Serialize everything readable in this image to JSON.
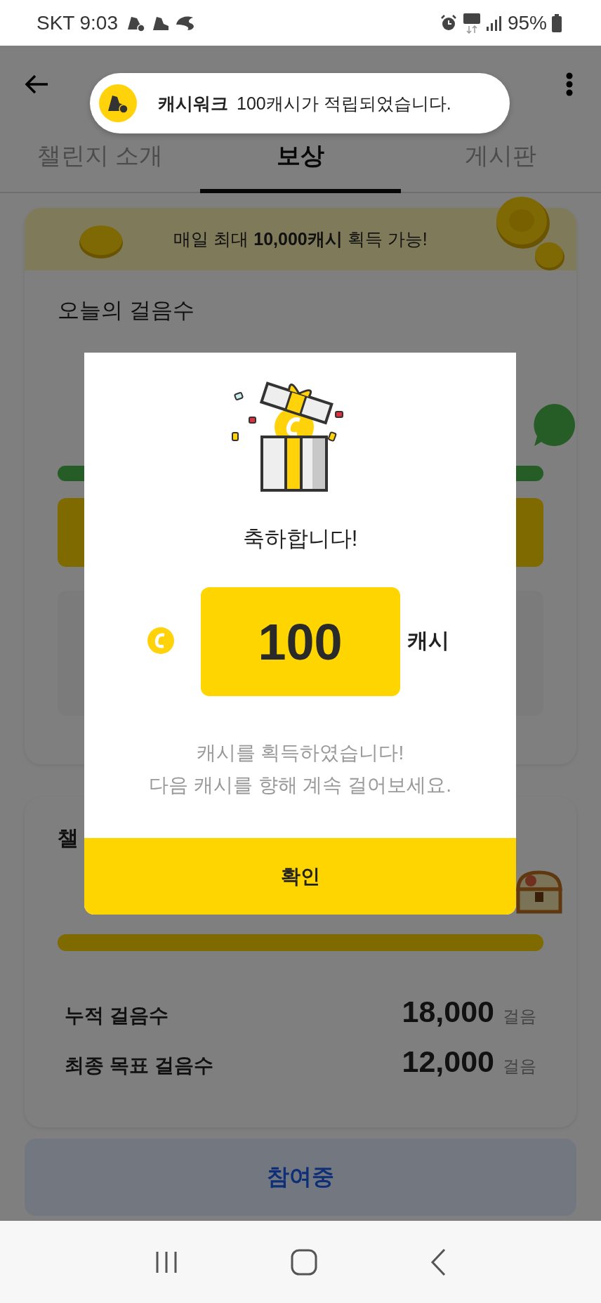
{
  "status_bar": {
    "carrier": "SKT",
    "time": "9:03",
    "battery": "95%"
  },
  "toast": {
    "app": "캐시워크",
    "message": "100캐시가 적립되었습니다."
  },
  "tabs": [
    {
      "label": "챌린지 소개",
      "selected": false
    },
    {
      "label": "보상",
      "selected": true
    },
    {
      "label": "게시판",
      "selected": false
    }
  ],
  "banner": {
    "text": "매일 최대 **10,000캐시** 획득 가능!"
  },
  "today_card": {
    "title": "오늘의 걸음수"
  },
  "challenge_card": {
    "title": "챌",
    "progress": {
      "level": 1
    },
    "stats": [
      {
        "label": "누적 걸음수",
        "value": "18,000",
        "unit": "걸음"
      },
      {
        "label": "최종 목표 걸음수",
        "value": "12,000",
        "unit": "걸음"
      }
    ]
  },
  "participate_button": "참여중",
  "dialog": {
    "title": "축하합니다!",
    "amount": "100",
    "unit": "캐시",
    "message_lines": [
      "캐시를 획득하였습니다!",
      "다음 캐시를 향해 계속 걸어보세요."
    ],
    "confirm": "확인"
  }
}
